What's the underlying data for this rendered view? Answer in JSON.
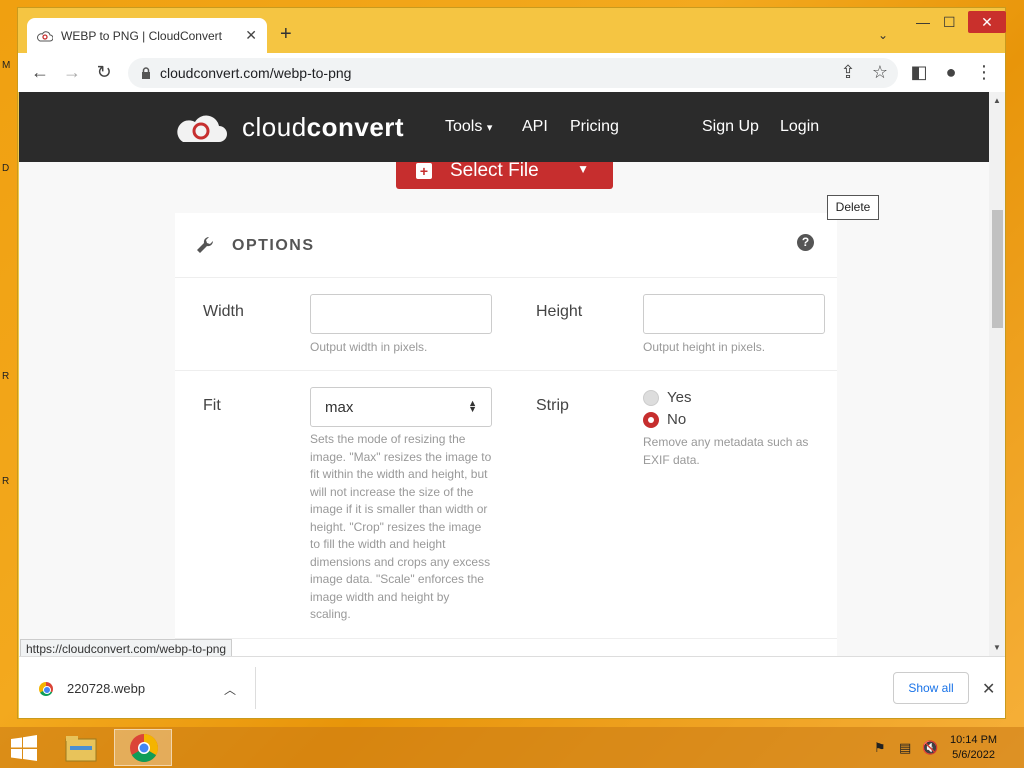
{
  "desktop": {
    "letters": [
      "M",
      "D",
      "R",
      "R"
    ]
  },
  "browser": {
    "tab_title": "WEBP to PNG | CloudConvert",
    "url": "cloudconvert.com/webp-to-png",
    "status_url": "https://cloudconvert.com/webp-to-png"
  },
  "site": {
    "logo_light": "cloud",
    "logo_bold": "convert",
    "nav": {
      "tools": "Tools",
      "api": "API",
      "pricing": "Pricing",
      "signup": "Sign Up",
      "login": "Login"
    },
    "select_file": "Select File",
    "tooltip": "Delete"
  },
  "options": {
    "title": "OPTIONS",
    "width": {
      "label": "Width",
      "value": "",
      "hint": "Output width in pixels."
    },
    "height": {
      "label": "Height",
      "value": "",
      "hint": "Output height in pixels."
    },
    "fit": {
      "label": "Fit",
      "value": "max",
      "hint": "Sets the mode of resizing the image. \"Max\" resizes the image to fit within the width and height, but will not increase the size of the image if it is smaller than width or height. \"Crop\" resizes the image to fill the width and height dimensions and crops any excess image data. \"Scale\" enforces the image width and height by scaling."
    },
    "strip": {
      "label": "Strip",
      "options": [
        {
          "label": "Yes",
          "selected": false
        },
        {
          "label": "No",
          "selected": true
        }
      ],
      "hint": "Remove any metadata such as EXIF data."
    }
  },
  "downloads": {
    "file": "220728.webp",
    "show_all": "Show all"
  },
  "taskbar": {
    "time": "10:14 PM",
    "date": "5/6/2022"
  },
  "colors": {
    "accent": "#c62e2e",
    "header": "#2b2b2b"
  }
}
